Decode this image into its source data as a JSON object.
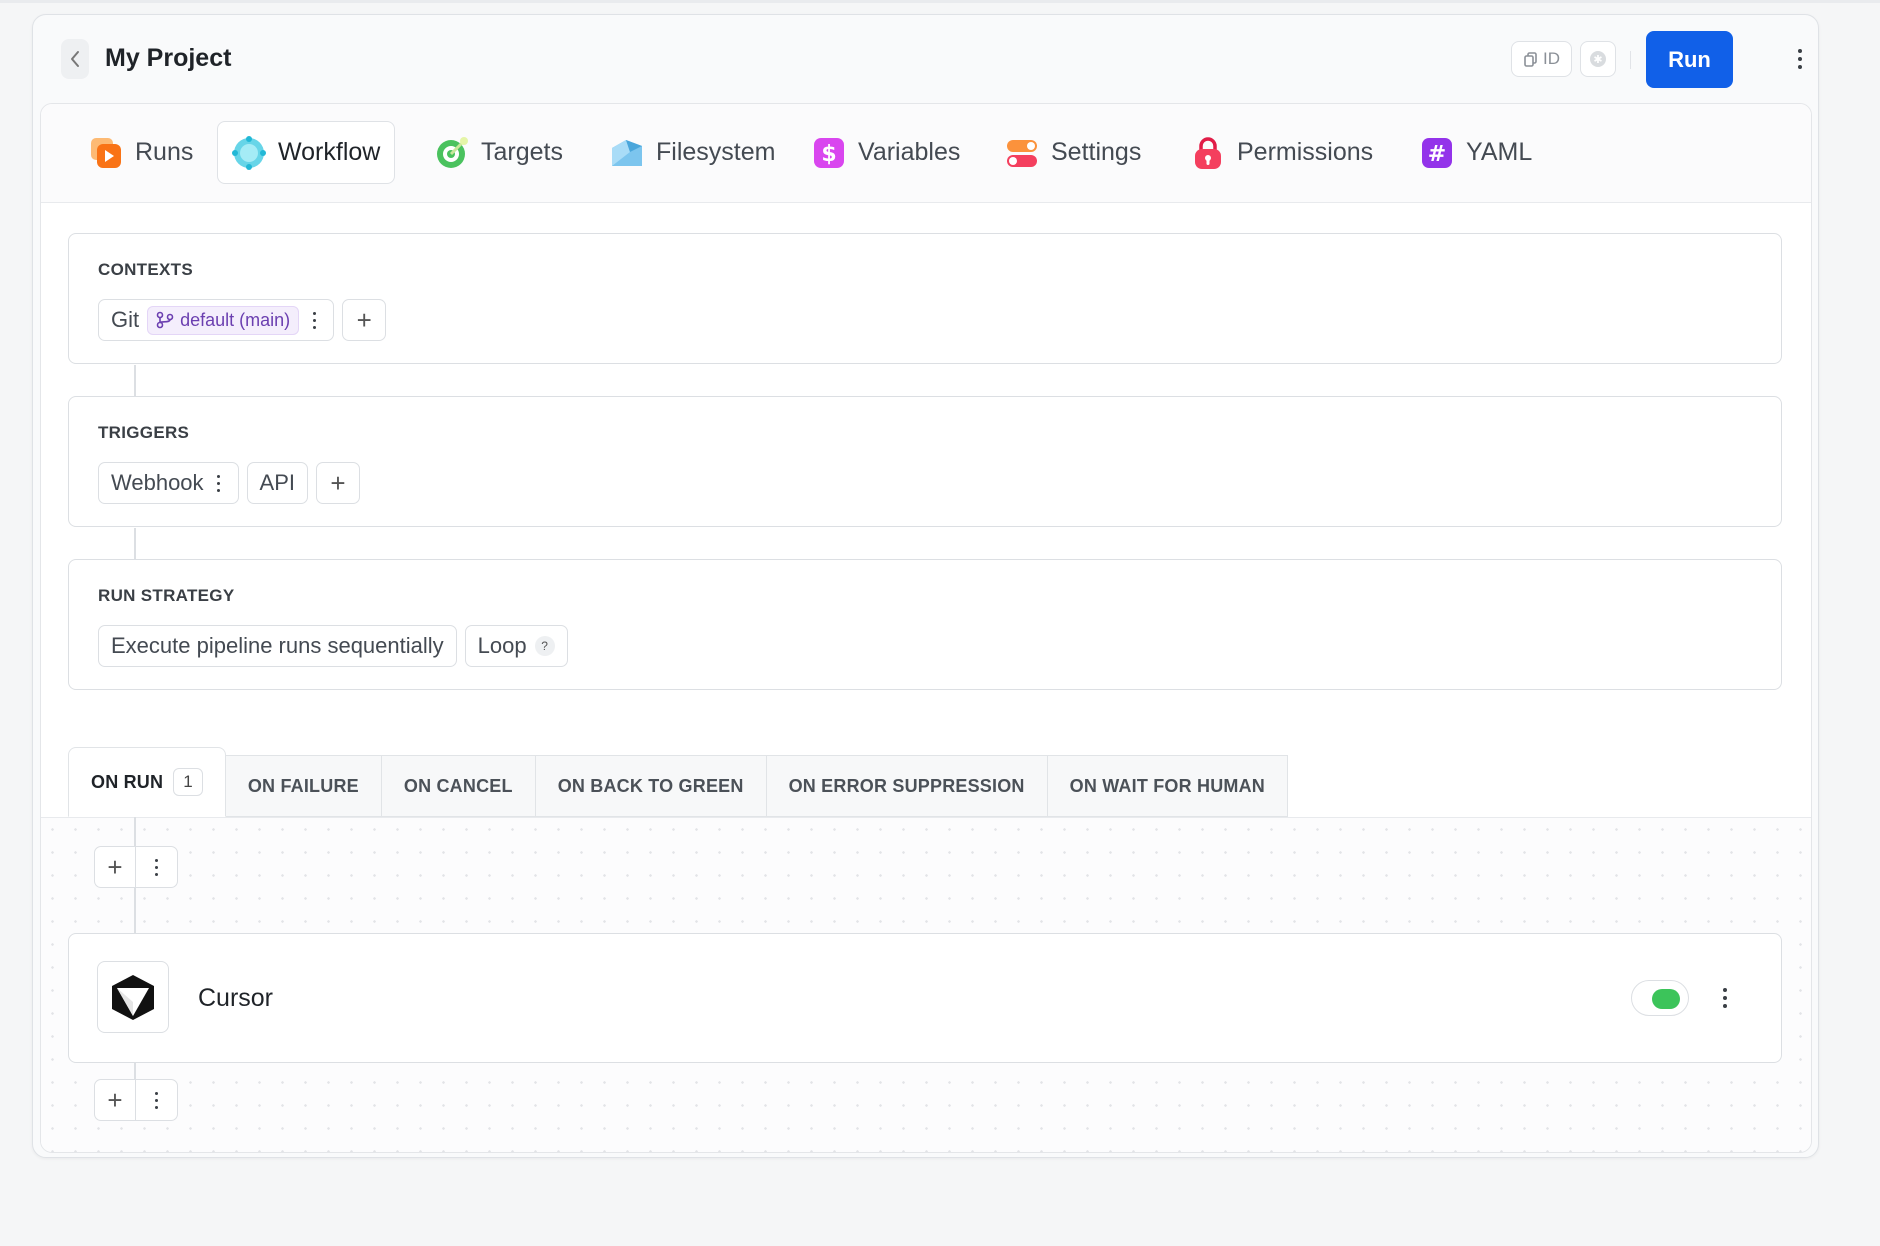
{
  "header": {
    "title": "My Project",
    "id_label": "ID",
    "run_label": "Run"
  },
  "tabs": [
    {
      "label": "Runs",
      "icon": "runs-icon"
    },
    {
      "label": "Workflow",
      "icon": "workflow-icon"
    },
    {
      "label": "Targets",
      "icon": "targets-icon"
    },
    {
      "label": "Filesystem",
      "icon": "filesystem-icon"
    },
    {
      "label": "Variables",
      "icon": "variables-icon"
    },
    {
      "label": "Settings",
      "icon": "settings-icon"
    },
    {
      "label": "Permissions",
      "icon": "permissions-icon"
    },
    {
      "label": "YAML",
      "icon": "yaml-icon"
    }
  ],
  "active_tab": "Workflow",
  "contexts": {
    "title": "CONTEXTS",
    "chip_label": "Git",
    "branch": "default (main)",
    "add": "+"
  },
  "triggers": {
    "title": "TRIGGERS",
    "items": [
      "Webhook",
      "API"
    ],
    "add": "+"
  },
  "run_strategy": {
    "title": "RUN STRATEGY",
    "mode": "Execute pipeline runs sequentially",
    "loop": "Loop",
    "help": "?"
  },
  "event_tabs": [
    {
      "label": "ON RUN",
      "count": "1"
    },
    {
      "label": "ON FAILURE"
    },
    {
      "label": "ON CANCEL"
    },
    {
      "label": "ON BACK TO GREEN"
    },
    {
      "label": "ON ERROR SUPPRESSION"
    },
    {
      "label": "ON WAIT FOR HUMAN"
    }
  ],
  "steps": [
    {
      "name": "Cursor",
      "enabled": true
    }
  ],
  "add_symbol": "+",
  "colors": {
    "accent": "#1160e8",
    "toggle_on": "#3cc45a",
    "branch_text": "#6b3fb0"
  }
}
